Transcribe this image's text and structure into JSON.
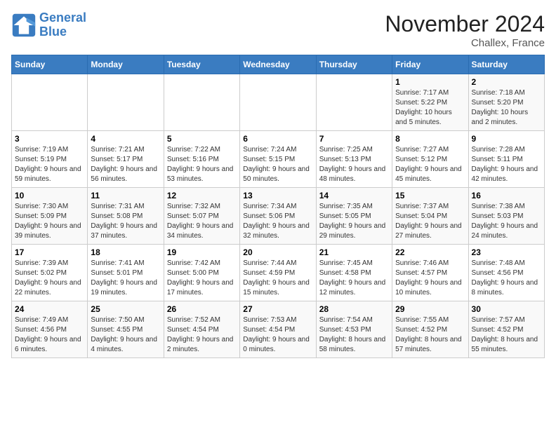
{
  "header": {
    "logo_line1": "General",
    "logo_line2": "Blue",
    "month_title": "November 2024",
    "location": "Challex, France"
  },
  "weekdays": [
    "Sunday",
    "Monday",
    "Tuesday",
    "Wednesday",
    "Thursday",
    "Friday",
    "Saturday"
  ],
  "weeks": [
    [
      {
        "day": "",
        "sunrise": "",
        "sunset": "",
        "daylight": ""
      },
      {
        "day": "",
        "sunrise": "",
        "sunset": "",
        "daylight": ""
      },
      {
        "day": "",
        "sunrise": "",
        "sunset": "",
        "daylight": ""
      },
      {
        "day": "",
        "sunrise": "",
        "sunset": "",
        "daylight": ""
      },
      {
        "day": "",
        "sunrise": "",
        "sunset": "",
        "daylight": ""
      },
      {
        "day": "1",
        "sunrise": "Sunrise: 7:17 AM",
        "sunset": "Sunset: 5:22 PM",
        "daylight": "Daylight: 10 hours and 5 minutes."
      },
      {
        "day": "2",
        "sunrise": "Sunrise: 7:18 AM",
        "sunset": "Sunset: 5:20 PM",
        "daylight": "Daylight: 10 hours and 2 minutes."
      }
    ],
    [
      {
        "day": "3",
        "sunrise": "Sunrise: 7:19 AM",
        "sunset": "Sunset: 5:19 PM",
        "daylight": "Daylight: 9 hours and 59 minutes."
      },
      {
        "day": "4",
        "sunrise": "Sunrise: 7:21 AM",
        "sunset": "Sunset: 5:17 PM",
        "daylight": "Daylight: 9 hours and 56 minutes."
      },
      {
        "day": "5",
        "sunrise": "Sunrise: 7:22 AM",
        "sunset": "Sunset: 5:16 PM",
        "daylight": "Daylight: 9 hours and 53 minutes."
      },
      {
        "day": "6",
        "sunrise": "Sunrise: 7:24 AM",
        "sunset": "Sunset: 5:15 PM",
        "daylight": "Daylight: 9 hours and 50 minutes."
      },
      {
        "day": "7",
        "sunrise": "Sunrise: 7:25 AM",
        "sunset": "Sunset: 5:13 PM",
        "daylight": "Daylight: 9 hours and 48 minutes."
      },
      {
        "day": "8",
        "sunrise": "Sunrise: 7:27 AM",
        "sunset": "Sunset: 5:12 PM",
        "daylight": "Daylight: 9 hours and 45 minutes."
      },
      {
        "day": "9",
        "sunrise": "Sunrise: 7:28 AM",
        "sunset": "Sunset: 5:11 PM",
        "daylight": "Daylight: 9 hours and 42 minutes."
      }
    ],
    [
      {
        "day": "10",
        "sunrise": "Sunrise: 7:30 AM",
        "sunset": "Sunset: 5:09 PM",
        "daylight": "Daylight: 9 hours and 39 minutes."
      },
      {
        "day": "11",
        "sunrise": "Sunrise: 7:31 AM",
        "sunset": "Sunset: 5:08 PM",
        "daylight": "Daylight: 9 hours and 37 minutes."
      },
      {
        "day": "12",
        "sunrise": "Sunrise: 7:32 AM",
        "sunset": "Sunset: 5:07 PM",
        "daylight": "Daylight: 9 hours and 34 minutes."
      },
      {
        "day": "13",
        "sunrise": "Sunrise: 7:34 AM",
        "sunset": "Sunset: 5:06 PM",
        "daylight": "Daylight: 9 hours and 32 minutes."
      },
      {
        "day": "14",
        "sunrise": "Sunrise: 7:35 AM",
        "sunset": "Sunset: 5:05 PM",
        "daylight": "Daylight: 9 hours and 29 minutes."
      },
      {
        "day": "15",
        "sunrise": "Sunrise: 7:37 AM",
        "sunset": "Sunset: 5:04 PM",
        "daylight": "Daylight: 9 hours and 27 minutes."
      },
      {
        "day": "16",
        "sunrise": "Sunrise: 7:38 AM",
        "sunset": "Sunset: 5:03 PM",
        "daylight": "Daylight: 9 hours and 24 minutes."
      }
    ],
    [
      {
        "day": "17",
        "sunrise": "Sunrise: 7:39 AM",
        "sunset": "Sunset: 5:02 PM",
        "daylight": "Daylight: 9 hours and 22 minutes."
      },
      {
        "day": "18",
        "sunrise": "Sunrise: 7:41 AM",
        "sunset": "Sunset: 5:01 PM",
        "daylight": "Daylight: 9 hours and 19 minutes."
      },
      {
        "day": "19",
        "sunrise": "Sunrise: 7:42 AM",
        "sunset": "Sunset: 5:00 PM",
        "daylight": "Daylight: 9 hours and 17 minutes."
      },
      {
        "day": "20",
        "sunrise": "Sunrise: 7:44 AM",
        "sunset": "Sunset: 4:59 PM",
        "daylight": "Daylight: 9 hours and 15 minutes."
      },
      {
        "day": "21",
        "sunrise": "Sunrise: 7:45 AM",
        "sunset": "Sunset: 4:58 PM",
        "daylight": "Daylight: 9 hours and 12 minutes."
      },
      {
        "day": "22",
        "sunrise": "Sunrise: 7:46 AM",
        "sunset": "Sunset: 4:57 PM",
        "daylight": "Daylight: 9 hours and 10 minutes."
      },
      {
        "day": "23",
        "sunrise": "Sunrise: 7:48 AM",
        "sunset": "Sunset: 4:56 PM",
        "daylight": "Daylight: 9 hours and 8 minutes."
      }
    ],
    [
      {
        "day": "24",
        "sunrise": "Sunrise: 7:49 AM",
        "sunset": "Sunset: 4:56 PM",
        "daylight": "Daylight: 9 hours and 6 minutes."
      },
      {
        "day": "25",
        "sunrise": "Sunrise: 7:50 AM",
        "sunset": "Sunset: 4:55 PM",
        "daylight": "Daylight: 9 hours and 4 minutes."
      },
      {
        "day": "26",
        "sunrise": "Sunrise: 7:52 AM",
        "sunset": "Sunset: 4:54 PM",
        "daylight": "Daylight: 9 hours and 2 minutes."
      },
      {
        "day": "27",
        "sunrise": "Sunrise: 7:53 AM",
        "sunset": "Sunset: 4:54 PM",
        "daylight": "Daylight: 9 hours and 0 minutes."
      },
      {
        "day": "28",
        "sunrise": "Sunrise: 7:54 AM",
        "sunset": "Sunset: 4:53 PM",
        "daylight": "Daylight: 8 hours and 58 minutes."
      },
      {
        "day": "29",
        "sunrise": "Sunrise: 7:55 AM",
        "sunset": "Sunset: 4:52 PM",
        "daylight": "Daylight: 8 hours and 57 minutes."
      },
      {
        "day": "30",
        "sunrise": "Sunrise: 7:57 AM",
        "sunset": "Sunset: 4:52 PM",
        "daylight": "Daylight: 8 hours and 55 minutes."
      }
    ]
  ]
}
